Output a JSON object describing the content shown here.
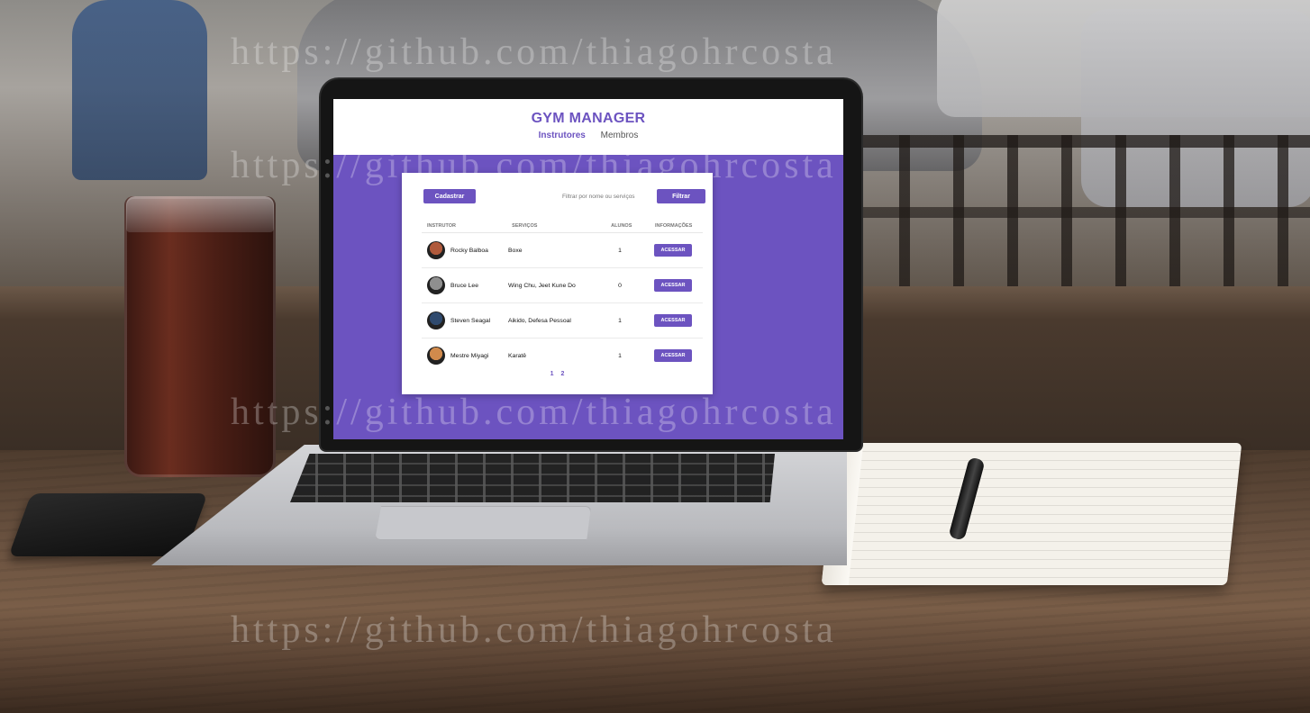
{
  "app": {
    "title": "GYM MANAGER",
    "nav": [
      "Instrutores",
      "Membros"
    ],
    "active_nav": "Instrutores"
  },
  "toolbar": {
    "new_label": "Cadastrar",
    "filter_placeholder": "Filtrar por nome ou serviços",
    "filter_label": "Filtrar"
  },
  "table": {
    "headers": [
      "INSTRUTOR",
      "SERVIÇOS",
      "ALUNOS",
      "INFORMAÇÕES"
    ],
    "rows": [
      {
        "name": "Rocky Balboa",
        "services": "Boxe",
        "students": "1",
        "action": "ACESSAR",
        "avatar_color": "#b05a3c"
      },
      {
        "name": "Bruce Lee",
        "services": "Wing Chu, Jeet Kune Do",
        "students": "0",
        "action": "ACESSAR",
        "avatar_color": "#8f8f8f"
      },
      {
        "name": "Steven Seagal",
        "services": "Aikido, Defesa Pessoal",
        "students": "1",
        "action": "ACESSAR",
        "avatar_color": "#2f4a6e"
      },
      {
        "name": "Mestre Miyagi",
        "services": "Karatê",
        "students": "1",
        "action": "ACESSAR",
        "avatar_color": "#d08a4c"
      }
    ]
  },
  "pagination": [
    "1",
    "2"
  ],
  "watermark": "https://github.com/thiagohrcosta",
  "colors": {
    "accent": "#6c53c0",
    "card": "#ffffff"
  }
}
